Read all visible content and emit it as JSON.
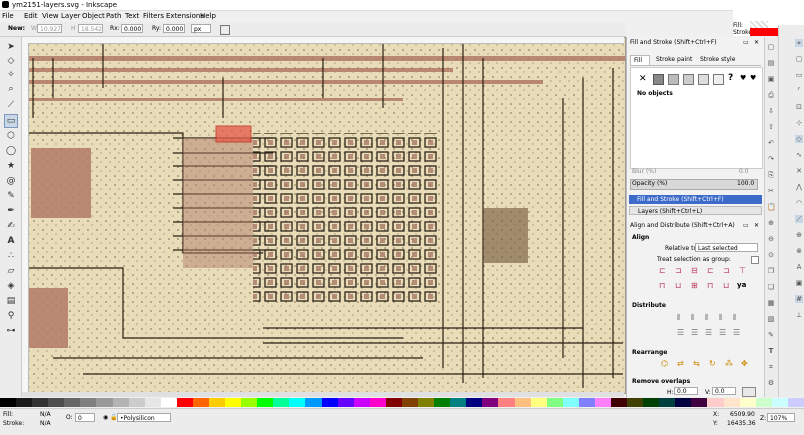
{
  "window": {
    "title": "ym2151-layers.svg - Inkscape"
  },
  "fill_indicator": {
    "fill_label": "Fill:",
    "stroke_label": "Stroke:"
  },
  "menu": [
    "File",
    "Edit",
    "View",
    "Layer",
    "Object",
    "Path",
    "Text",
    "Filters",
    "Extensions",
    "Help"
  ],
  "controls": {
    "new_label": "New:",
    "w_label": "W",
    "w_value": "10.927",
    "h_label": "H",
    "h_value": "18.542",
    "rx_label": "Rx:",
    "rx_value": "0.000",
    "ry_label": "Ry:",
    "ry_value": "0.000",
    "unit": "px"
  },
  "fill_stroke_panel": {
    "title": "Fill and Stroke (Shift+Ctrl+F)",
    "tabs": [
      "Fill",
      "Stroke paint",
      "Stroke style"
    ],
    "no_objects": "No objects",
    "blur_label": "Blur (%)",
    "blur_value": "0.0",
    "opacity_label": "Opacity (%)",
    "opacity_value": "100.0"
  },
  "dock_tabs": {
    "fill_stroke": "Fill and Stroke (Shift+Ctrl+F)",
    "layers": "Layers (Shift+Ctrl+L)"
  },
  "align_panel": {
    "title": "Align and Distribute (Shift+Ctrl+A)",
    "align_heading": "Align",
    "relative_label": "Relative to:",
    "relative_value": "Last selected",
    "treat_group": "Treat selection as group:",
    "distribute_heading": "Distribute",
    "rearrange_heading": "Rearrange",
    "remove_overlaps_heading": "Remove overlaps",
    "h_label": "H:",
    "h_value": "0.0",
    "v_label": "V:",
    "v_value": "0.0"
  },
  "status": {
    "fill_label": "Fill:",
    "fill_value": "N/A",
    "stroke_label": "Stroke:",
    "stroke_value": "N/A",
    "opacity_value": "0",
    "layer_name": "•Polysilicon",
    "x_label": "X:",
    "x_value": "6509.90",
    "y_label": "Y:",
    "y_value": "16435.36",
    "z_label": "Z:",
    "zoom": "107%"
  },
  "palette": [
    "#000000",
    "#1a1a1a",
    "#333333",
    "#4d4d4d",
    "#666666",
    "#808080",
    "#999999",
    "#b3b3b3",
    "#cccccc",
    "#e6e6e6",
    "#ffffff",
    "#ff0000",
    "#ff6600",
    "#ffcc00",
    "#ffff00",
    "#99ff00",
    "#00ff00",
    "#00ff99",
    "#00ffff",
    "#0099ff",
    "#0000ff",
    "#6600ff",
    "#cc00ff",
    "#ff00cc",
    "#800000",
    "#804000",
    "#808000",
    "#008000",
    "#008080",
    "#000080",
    "#800080",
    "#ff8080",
    "#ffc080",
    "#ffff80",
    "#80ff80",
    "#80ffff",
    "#8080ff",
    "#ff80ff",
    "#400000",
    "#404000",
    "#004000",
    "#004040",
    "#000040",
    "#400040",
    "#ffcccc",
    "#ffe5cc",
    "#ffffcc",
    "#ccffcc",
    "#ccffff",
    "#ccccff"
  ]
}
